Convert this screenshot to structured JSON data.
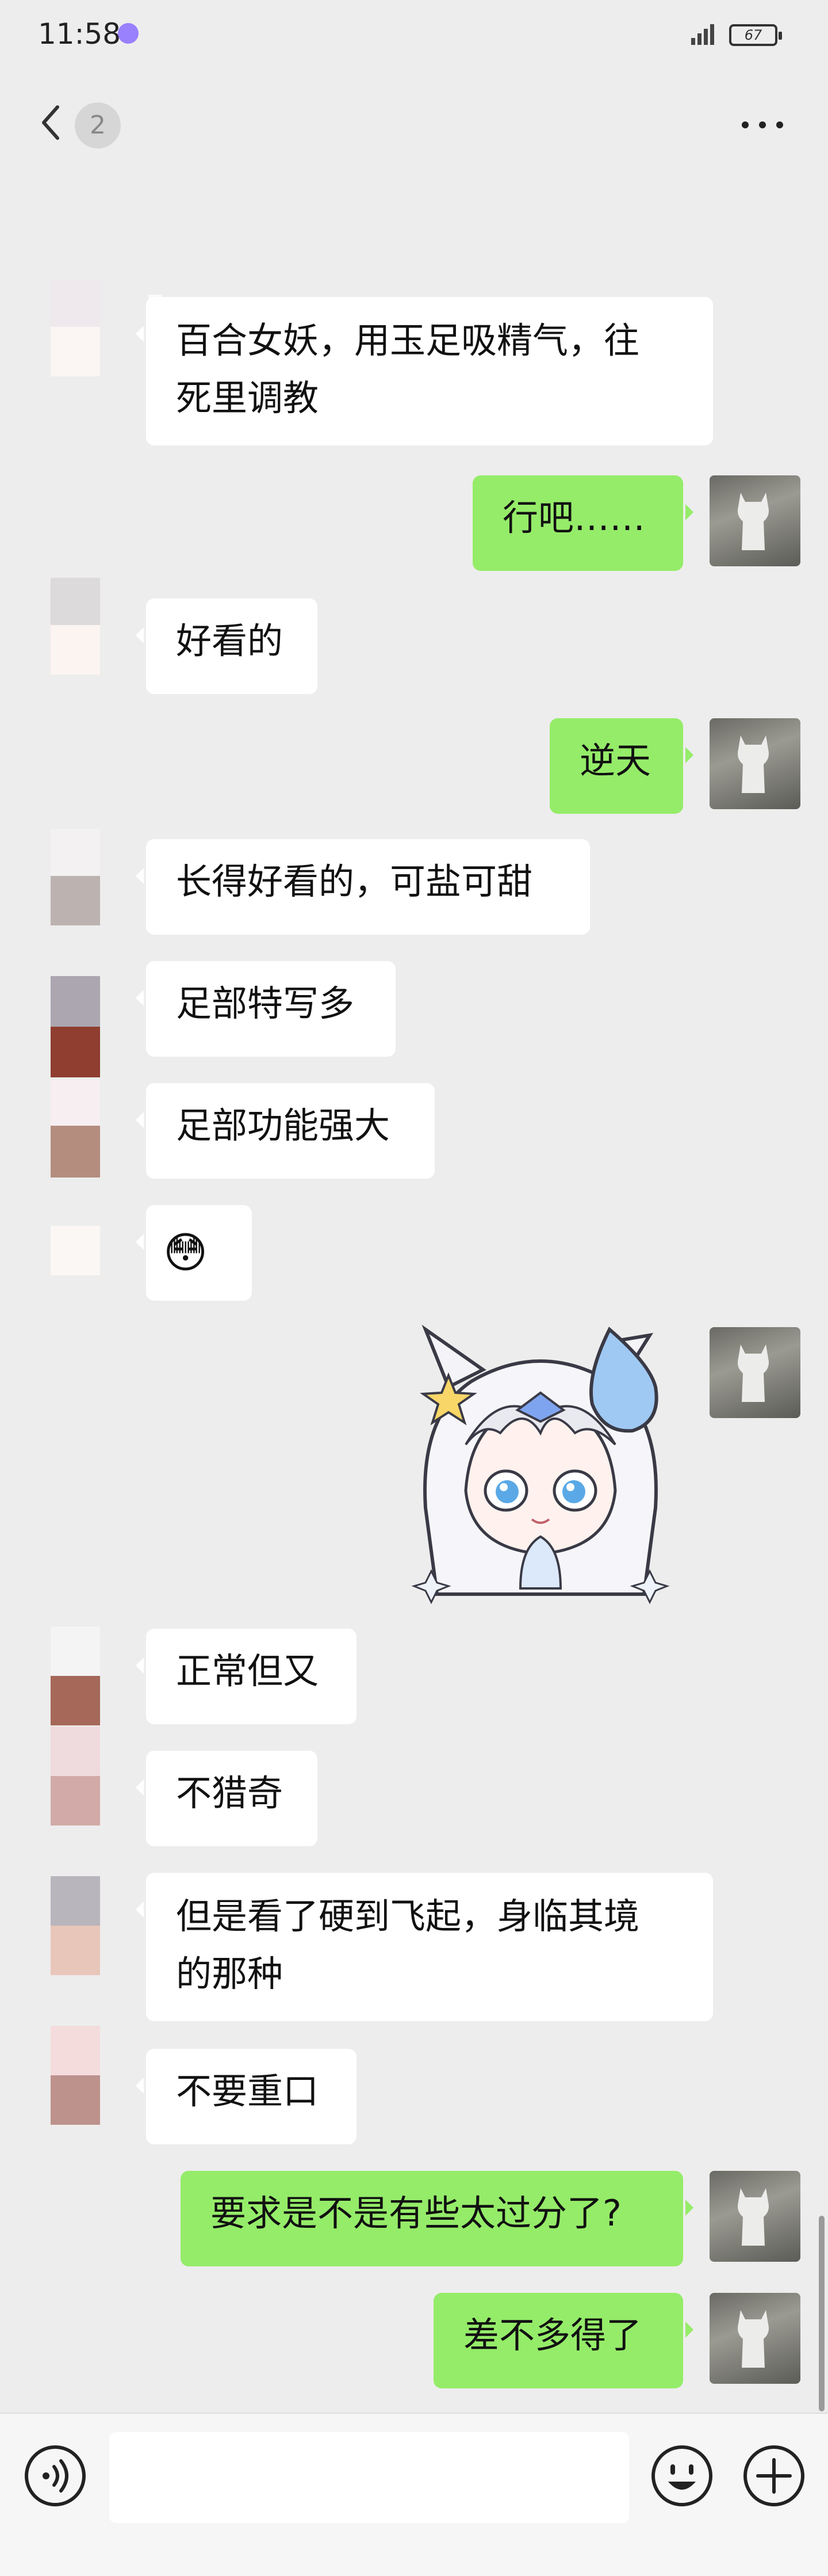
{
  "status_bar": {
    "time": "11:58",
    "battery": "67"
  },
  "header": {
    "avatar_text": "2"
  },
  "messages": [
    {
      "side": "in",
      "text_line1": "百合女妖，用玉足吸精气，往",
      "text_line2": "死里调教"
    },
    {
      "side": "out",
      "text": "行吧……"
    },
    {
      "side": "in",
      "text": "好看的"
    },
    {
      "side": "out",
      "text": "逆天"
    },
    {
      "side": "in",
      "text": "长得好看的，可盐可甜"
    },
    {
      "side": "in",
      "text": "足部特写多"
    },
    {
      "side": "in",
      "text": "足部功能强大"
    },
    {
      "side": "in",
      "text": "😳"
    },
    {
      "side": "out",
      "sticker": "anime-girl-sweat-sticker"
    },
    {
      "side": "in",
      "text": "正常但又"
    },
    {
      "side": "in",
      "text": "不猎奇"
    },
    {
      "side": "in",
      "text_line1": "但是看了硬到飞起，身临其境",
      "text_line2": "的那种"
    },
    {
      "side": "in",
      "text": "不要重口"
    },
    {
      "side": "out",
      "text": "要求是不是有些太过分了?"
    },
    {
      "side": "out",
      "text": "差不多得了"
    }
  ],
  "colors": {
    "out_bubble": "#95ec69",
    "in_bubble": "#ffffff",
    "background": "#ededed"
  },
  "icons": [
    "back-icon",
    "more-icon",
    "voice-icon",
    "emoji-icon",
    "plus-icon"
  ]
}
